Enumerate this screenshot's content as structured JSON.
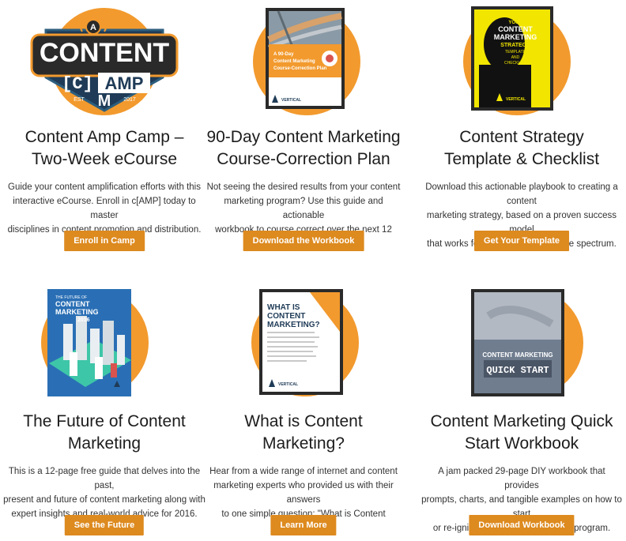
{
  "cards": [
    {
      "title_line1": "Content Amp Camp –",
      "title_line2": "Two-Week eCourse",
      "desc_line1": "Guide your content amplification efforts with this",
      "desc_line2": "interactive eCourse. Enroll in c[AMP] today to master",
      "desc_line3": "disciplines in content promotion and distribution.",
      "button": "Enroll in Camp",
      "logo": {
        "top": "CONTENT",
        "bracket": "[C]",
        "amp": "AMP",
        "est": "EST",
        "year": "2017",
        "mark": "M",
        "a_badge": "A"
      }
    },
    {
      "title_line1": "90-Day Content Marketing",
      "title_line2": "Course-Correction Plan",
      "desc_line1": "Not seeing the desired results from your content",
      "desc_line2": "marketing program? Use this guide and actionable",
      "desc_line3": "workbook to course correct over the next 12 weeks.",
      "button": "Download the Workbook",
      "cover": {
        "line1": "A 90-Day",
        "line2": "Content Marketing",
        "line3": "Course-Correction Plan",
        "brand": "VERTICAL"
      }
    },
    {
      "title_line1": "Content Strategy",
      "title_line2": "Template & Checklist",
      "desc_line1": "Download this actionable playbook to creating a content",
      "desc_line2": "marketing strategy, based on a proven success model",
      "desc_line3": "that works for businesses across the spectrum.",
      "button": "Get Your Template",
      "cover": {
        "line1": "YOUR",
        "line2": "CONTENT",
        "line3": "MARKETING",
        "line4": "STRATEGY",
        "line5": "TEMPLATE",
        "line6": "AND",
        "line7": "CHECKLIST",
        "brand": "VERTICAL"
      }
    },
    {
      "title_line1": "The Future of Content",
      "title_line2": "Marketing",
      "desc_line1": "This is a 12-page free guide that delves into the past,",
      "desc_line2": "present and future of content marketing along with",
      "desc_line3": "expert insights and real-world advice for 2016.",
      "button": "See the Future",
      "cover": {
        "line1": "THE FUTURE OF",
        "line2": "CONTENT",
        "line3": "MARKETING",
        "line4": "2016"
      }
    },
    {
      "title_line1": "What is Content",
      "title_line2": "Marketing?",
      "desc_line1": "Hear from a wide range of internet and content",
      "desc_line2": "marketing experts who provided us with their answers",
      "desc_line3": "to one simple question: \"What is Content Marketing?\"",
      "button": "Learn More",
      "cover": {
        "line1": "WHAT IS",
        "line2": "CONTENT",
        "line3": "MARKETING?",
        "brand": "VERTICAL"
      }
    },
    {
      "title_line1": "Content Marketing Quick",
      "title_line2": "Start Workbook",
      "desc_line1": "A jam packed 29-page DIY workbook that provides",
      "desc_line2": "prompts, charts, and tangible examples on how to start",
      "desc_line3": "or re-ignite your content marketing program.",
      "button": "Download Workbook",
      "cover": {
        "line1": "CONTENT MARKETING",
        "line2": "QUICK START"
      }
    }
  ],
  "colors": {
    "orange_circle": "#f29a2e",
    "button": "#dd8a1f",
    "navy": "#1f3b57",
    "yellow": "#f2e600"
  }
}
